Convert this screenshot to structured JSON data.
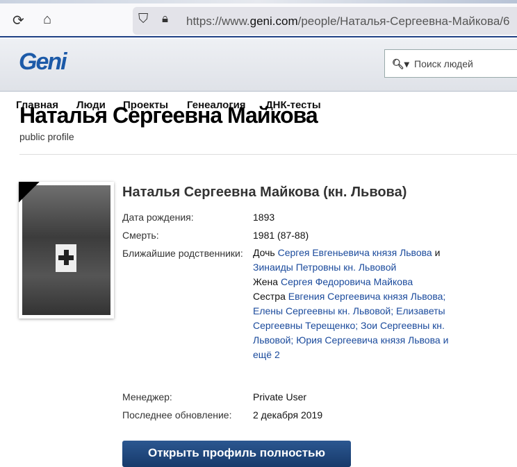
{
  "browser": {
    "url_prefix": "https://www.",
    "url_domain": "geni.com",
    "url_path": "/people/Наталья-Сергеевна-Майкова/6"
  },
  "site": {
    "logo": "Geni",
    "search_placeholder": "Поиск людей"
  },
  "nav": [
    "Главная",
    "Люди",
    "Проекты",
    "Генеалогия",
    "ДНК-тесты"
  ],
  "page": {
    "title": "Наталья Сергеевна Майкова",
    "subtitle": "public profile"
  },
  "profile": {
    "name": "Наталья Сергеевна Майкова (кн. Львова)",
    "birth_label": "Дата рождения:",
    "birth": "1893",
    "death_label": "Смерть:",
    "death": "1981 (87-88)",
    "relatives_label": "Ближайшие родственники:",
    "relatives": [
      {
        "t": "text",
        "v": "Дочь "
      },
      {
        "t": "link",
        "v": "Сергея Евгеньевича князя Львова"
      },
      {
        "t": "text",
        "v": " и "
      },
      {
        "t": "link",
        "v": "Зинаиды Петровны кн. Львовой"
      },
      {
        "t": "br"
      },
      {
        "t": "text",
        "v": "Жена "
      },
      {
        "t": "link",
        "v": "Сергея Федоровича Майкова"
      },
      {
        "t": "br"
      },
      {
        "t": "text",
        "v": "Сестра "
      },
      {
        "t": "link",
        "v": "Евгения Сергеевича князя Львова; Елены Сергеевны кн. Львовой; Елизаветы Сергеевны Терещенко; Зои Сергеевны кн. Львовой; Юрия Сергеевича князя Львова"
      },
      {
        "t": "text",
        "v": " "
      },
      {
        "t": "link",
        "v": "и ещё 2"
      }
    ],
    "manager_label": "Менеджер:",
    "manager": "Private User",
    "updated_label": "Последнее обновление:",
    "updated": "2 декабря 2019",
    "open_button": "Открыть профиль полностью"
  }
}
